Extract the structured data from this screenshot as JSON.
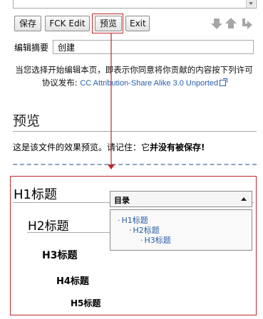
{
  "toolbar": {
    "save_label": "保存",
    "fck_label": "FCK Edit",
    "preview_label": "预览",
    "exit_label": "Exit"
  },
  "nav_icons": [
    "arrow-down-icon",
    "arrow-up-icon",
    "return-arrow-icon"
  ],
  "summary": {
    "label": "编辑摘要",
    "value": "创建"
  },
  "notice": {
    "text": "当您选择开始编辑本页，即表示你同意将你贡献的内容按下列许可协议发布:",
    "license_link": "CC Attribution-Share Alike 3.0 Unported"
  },
  "preview": {
    "heading": "预览",
    "note_prefix": "这是该文件的效果预览。请记住：它",
    "note_bold": "并没有被保存!"
  },
  "content": {
    "h1": "H1标题",
    "h2": "H2标题",
    "h3": "H3标题",
    "h4": "H4标题",
    "h5": "H5标题"
  },
  "toc": {
    "title": "目录",
    "items": [
      "H1标题",
      "H2标题",
      "H3标题"
    ]
  },
  "colors": {
    "highlight": "#c0272d",
    "link": "#2b5fa7",
    "dashed_rule": "#8aa6c1"
  }
}
